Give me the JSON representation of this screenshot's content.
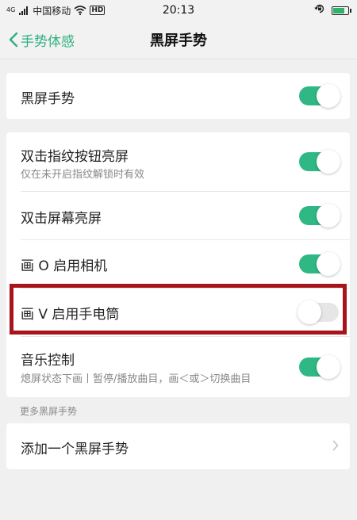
{
  "status_bar": {
    "network_type": "4G",
    "carrier": "中国移动",
    "hd": "HD",
    "time": "20:13",
    "battery_level": 0.85
  },
  "header": {
    "back_label": "手势体感",
    "title": "黑屏手势"
  },
  "settings": {
    "main_toggle": {
      "label": "黑屏手势",
      "enabled": true
    },
    "gestures": [
      {
        "label": "双击指纹按钮亮屏",
        "subtitle": "仅在未开启指纹解锁时有效",
        "enabled": true
      },
      {
        "label": "双击屏幕亮屏",
        "enabled": true
      },
      {
        "label": "画 O 启用相机",
        "enabled": true
      },
      {
        "label": "画 V 启用手电筒",
        "enabled": false
      },
      {
        "label": "音乐控制",
        "subtitle": "熄屏状态下画丨暂停/播放曲目，画＜或＞切换曲目",
        "enabled": true
      }
    ],
    "more_section": {
      "header": "更多黑屏手势",
      "add_label": "添加一个黑屏手势"
    }
  },
  "colors": {
    "accent": "#2fb784",
    "highlight_border": "#a8141b",
    "background": "#f0f0f0"
  },
  "icons": {
    "back": "chevron-left-icon",
    "add_row": "chevron-right-icon",
    "wifi": "wifi-icon",
    "battery": "battery-icon"
  }
}
